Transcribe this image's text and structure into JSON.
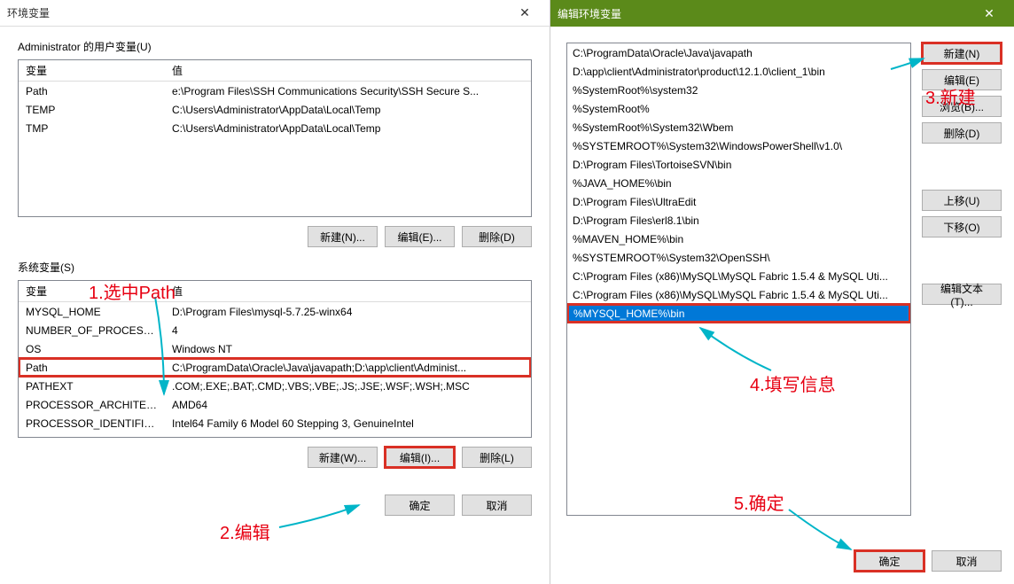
{
  "leftWindow": {
    "title": "环境变量",
    "userSection": "Administrator 的用户变量(U)",
    "userHeaders": {
      "var": "变量",
      "val": "值"
    },
    "userVars": [
      {
        "name": "Path",
        "value": "e:\\Program Files\\SSH Communications Security\\SSH Secure S..."
      },
      {
        "name": "TEMP",
        "value": "C:\\Users\\Administrator\\AppData\\Local\\Temp"
      },
      {
        "name": "TMP",
        "value": "C:\\Users\\Administrator\\AppData\\Local\\Temp"
      }
    ],
    "userButtons": {
      "new": "新建(N)...",
      "edit": "编辑(E)...",
      "delete": "删除(D)"
    },
    "sysSection": "系统变量(S)",
    "sysHeaders": {
      "var": "变量",
      "val": "值"
    },
    "sysVars": [
      {
        "name": "MYSQL_HOME",
        "value": "D:\\Program Files\\mysql-5.7.25-winx64"
      },
      {
        "name": "NUMBER_OF_PROCESSORS",
        "value": "4"
      },
      {
        "name": "OS",
        "value": "Windows NT"
      },
      {
        "name": "Path",
        "value": "C:\\ProgramData\\Oracle\\Java\\javapath;D:\\app\\client\\Administ..."
      },
      {
        "name": "PATHEXT",
        "value": ".COM;.EXE;.BAT;.CMD;.VBS;.VBE;.JS;.JSE;.WSF;.WSH;.MSC"
      },
      {
        "name": "PROCESSOR_ARCHITECTURE",
        "value": "AMD64"
      },
      {
        "name": "PROCESSOR_IDENTIFIER",
        "value": "Intel64 Family 6 Model 60 Stepping 3, GenuineIntel"
      }
    ],
    "sysButtons": {
      "new": "新建(W)...",
      "edit": "编辑(I)...",
      "delete": "删除(L)"
    },
    "dialogButtons": {
      "ok": "确定",
      "cancel": "取消"
    }
  },
  "rightWindow": {
    "title": "编辑环境变量",
    "paths": [
      "C:\\ProgramData\\Oracle\\Java\\javapath",
      "D:\\app\\client\\Administrator\\product\\12.1.0\\client_1\\bin",
      "%SystemRoot%\\system32",
      "%SystemRoot%",
      "%SystemRoot%\\System32\\Wbem",
      "%SYSTEMROOT%\\System32\\WindowsPowerShell\\v1.0\\",
      "D:\\Program Files\\TortoiseSVN\\bin",
      "%JAVA_HOME%\\bin",
      "D:\\Program Files\\UltraEdit",
      "D:\\Program Files\\erl8.1\\bin",
      "%MAVEN_HOME%\\bin",
      "%SYSTEMROOT%\\System32\\OpenSSH\\",
      "C:\\Program Files (x86)\\MySQL\\MySQL Fabric 1.5.4 & MySQL Uti...",
      "C:\\Program Files (x86)\\MySQL\\MySQL Fabric 1.5.4 & MySQL Uti...",
      "%MYSQL_HOME%\\bin"
    ],
    "selectedIndex": 14,
    "buttons": {
      "new": "新建(N)",
      "edit": "编辑(E)",
      "browse": "浏览(B)...",
      "delete": "删除(D)",
      "moveUp": "上移(U)",
      "moveDown": "下移(O)",
      "editText": "编辑文本(T)..."
    },
    "dialogButtons": {
      "ok": "确定",
      "cancel": "取消"
    }
  },
  "annotations": {
    "step1": "1.选中Path",
    "step2": "2.编辑",
    "step3": "3.新建",
    "step4": "4.填写信息",
    "step5": "5.确定"
  }
}
